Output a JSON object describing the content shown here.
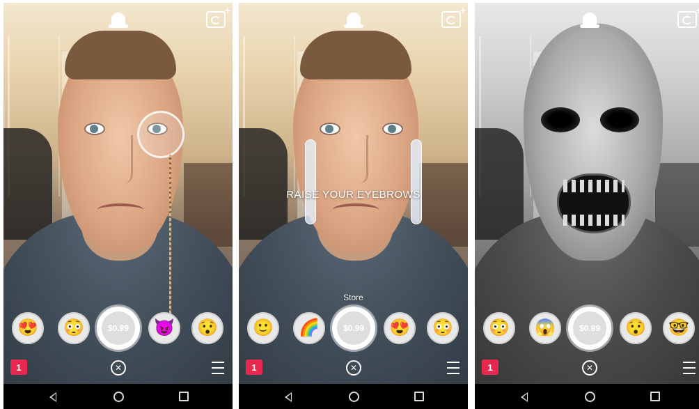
{
  "screens": [
    {
      "lenses": [
        "😍",
        "😳",
        "$0.99",
        "😈",
        "😯"
      ],
      "badge": "1",
      "overlay_text": "",
      "store_label": ""
    },
    {
      "lenses": [
        "🙂",
        "🌈",
        "$0.99",
        "😍",
        "😳"
      ],
      "badge": "1",
      "overlay_text": "RAISE YOUR EYEBROWS",
      "store_label": "Store"
    },
    {
      "lenses": [
        "😳",
        "😱",
        "$0.99",
        "😯",
        "🤓"
      ],
      "badge": "1",
      "overlay_text": "",
      "store_label": ""
    }
  ],
  "icons": {
    "top_center": "ghost-icon",
    "top_right": "camera-flip-icon",
    "close": "close-icon",
    "menu": "menu-icon",
    "nav": [
      "back-icon",
      "home-icon",
      "recent-apps-icon"
    ]
  },
  "colors": {
    "badge": "#e8284f"
  }
}
